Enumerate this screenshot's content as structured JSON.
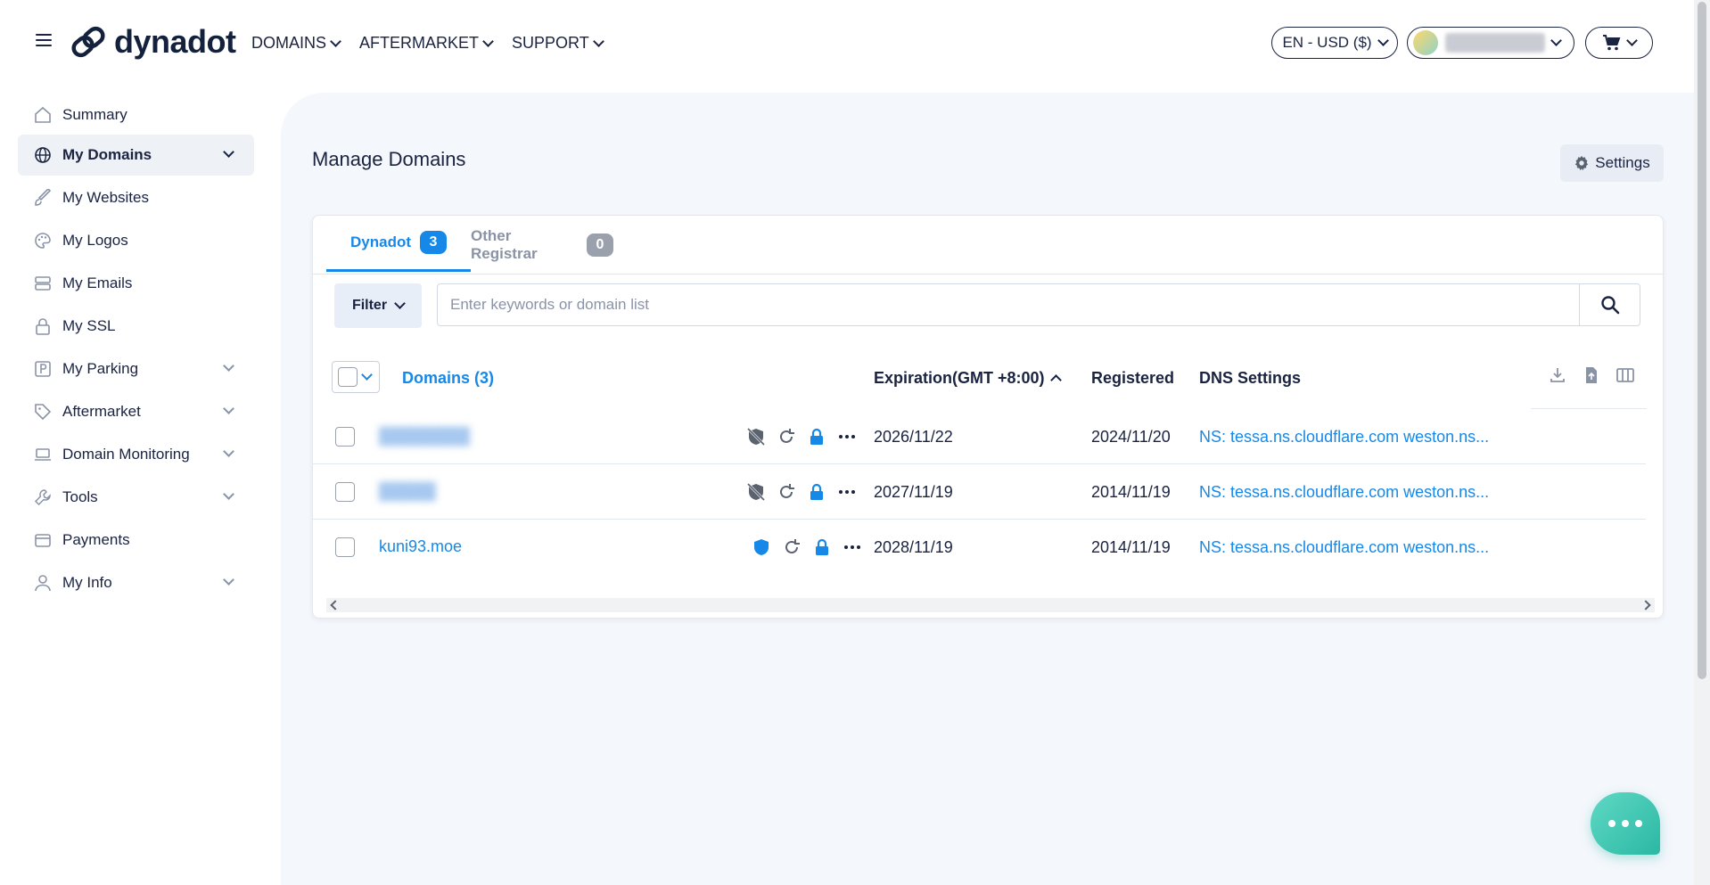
{
  "header": {
    "logo_text": "dynadot",
    "nav": [
      {
        "label": "DOMAINS"
      },
      {
        "label": "AFTERMARKET"
      },
      {
        "label": "SUPPORT"
      }
    ],
    "language_currency": "EN - USD ($)"
  },
  "sidebar": {
    "items": [
      {
        "label": "Summary"
      },
      {
        "label": "My Domains"
      },
      {
        "label": "My Websites"
      },
      {
        "label": "My Logos"
      },
      {
        "label": "My Emails"
      },
      {
        "label": "My SSL"
      },
      {
        "label": "My Parking"
      },
      {
        "label": "Aftermarket"
      },
      {
        "label": "Domain Monitoring"
      },
      {
        "label": "Tools"
      },
      {
        "label": "Payments"
      },
      {
        "label": "My Info"
      }
    ]
  },
  "main": {
    "title": "Manage Domains",
    "settings_label": "Settings",
    "tabs": [
      {
        "label": "Dynadot",
        "count": "3"
      },
      {
        "label": "Other Registrar",
        "count": "0"
      }
    ],
    "filter_label": "Filter",
    "search_placeholder": "Enter keywords or domain list",
    "columns": {
      "domains": "Domains (3)",
      "expiration": "Expiration(GMT +8:00)",
      "registered": "Registered",
      "dns": "DNS Settings"
    },
    "rows": [
      {
        "domain": "",
        "expiration": "2026/11/22",
        "registered": "2024/11/20",
        "dns": "NS: tessa.ns.cloudflare.com weston.ns..."
      },
      {
        "domain": "",
        "expiration": "2027/11/19",
        "registered": "2014/11/19",
        "dns": "NS: tessa.ns.cloudflare.com weston.ns..."
      },
      {
        "domain": "kuni93.moe",
        "expiration": "2028/11/19",
        "registered": "2014/11/19",
        "dns": "NS: tessa.ns.cloudflare.com weston.ns..."
      }
    ]
  },
  "colors": {
    "accent": "#1688e8",
    "text": "#1a2340",
    "main_bg": "#f4f7fc",
    "chat": "#2bb8a3"
  }
}
